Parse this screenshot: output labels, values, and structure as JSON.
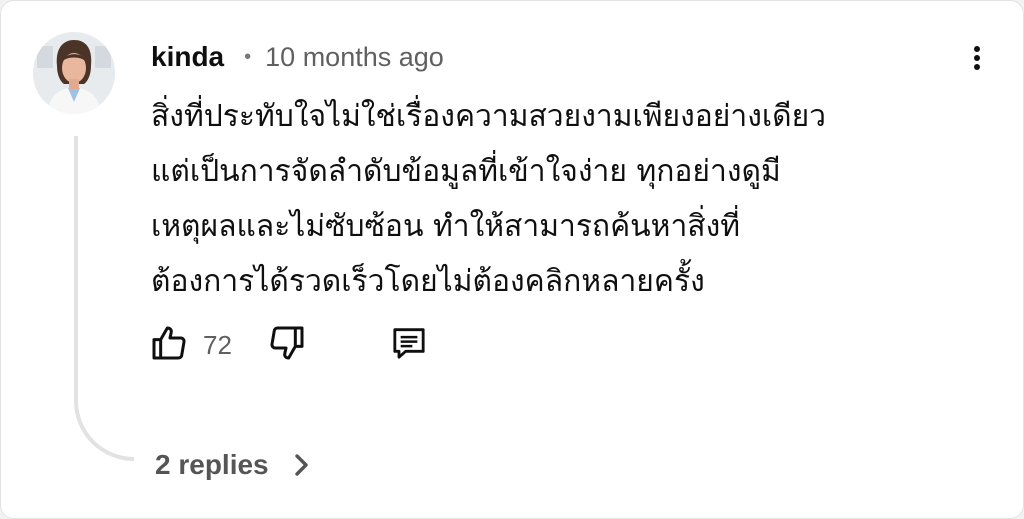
{
  "comment": {
    "author": "kinda",
    "separator": "•",
    "timestamp": "10 months ago",
    "text": "สิ่งที่ประทับใจไม่ใช่เรื่องความสวยงามเพียงอย่างเดียว\nแต่เป็นการจัดลำดับข้อมูลที่เข้าใจง่าย ทุกอย่างดูมี\nเหตุผลและไม่ซับซ้อน ทำให้สามารถค้นหาสิ่งที่\nต้องการได้รวดเร็วโดยไม่ต้องคลิกหลายครั้ง",
    "like_count": "72",
    "replies_label": "2 replies"
  },
  "icons": {
    "avatar": "avatar-photo",
    "like": "thumbs-up-icon",
    "dislike": "thumbs-down-icon",
    "reply": "comment-reply-icon",
    "replies_toggle": "chevron-right-icon",
    "menu": "more-vertical-icon"
  },
  "colors": {
    "text_primary": "#0f0f0f",
    "text_secondary": "#606060",
    "thread_line": "#e2e2e2"
  }
}
